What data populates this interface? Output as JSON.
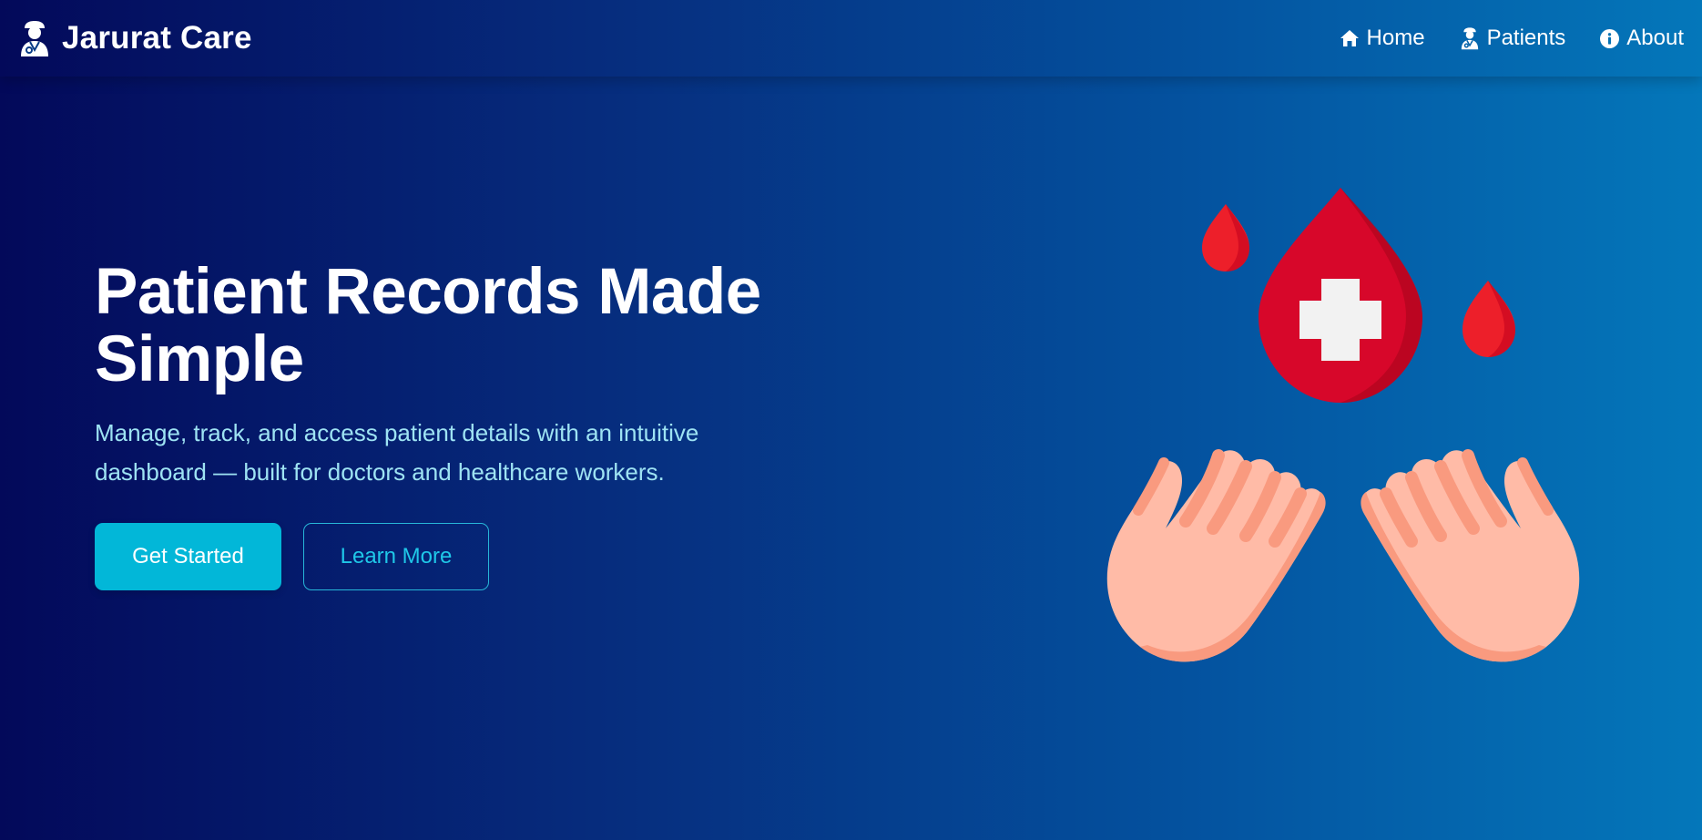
{
  "brand": {
    "name": "Jarurat Care",
    "icon": "doctor-icon"
  },
  "nav": {
    "items": [
      {
        "label": "Home",
        "icon": "home-icon"
      },
      {
        "label": "Patients",
        "icon": "doctor-icon"
      },
      {
        "label": "About",
        "icon": "info-circle-icon"
      }
    ]
  },
  "hero": {
    "title_line1": "Patient Records Made",
    "title_line2": "Simple",
    "subtitle_line1": "Manage, track, and access patient details with an intuitive",
    "subtitle_line2": "dashboard — built for doctors and healthcare workers.",
    "primary_button": "Get Started",
    "secondary_button": "Learn More"
  },
  "illustration": {
    "icon": "blood-donation-hands-icon"
  },
  "colors": {
    "gradient_start": "#03095a",
    "gradient_end": "#0477ba",
    "accent": "#02b7d8",
    "subtitle": "#9ee3f3",
    "blood_red": "#d7072a",
    "skin": "#ffbba7",
    "skin_shadow": "#f99a7f"
  }
}
